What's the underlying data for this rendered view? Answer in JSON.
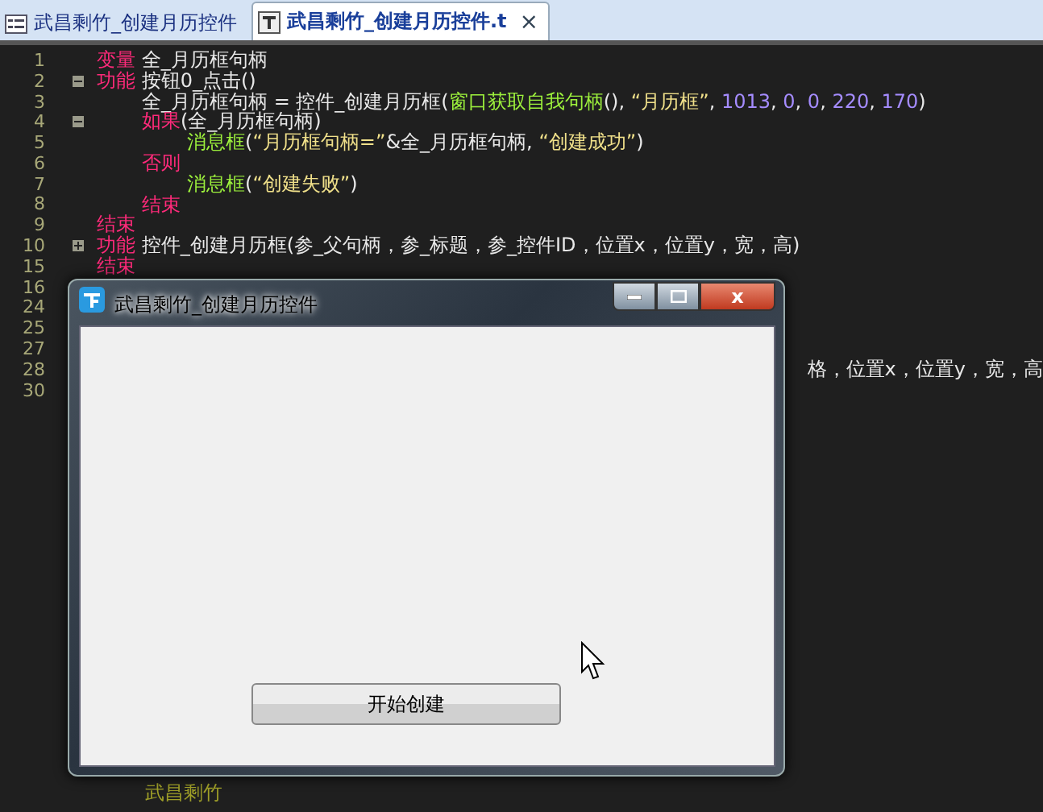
{
  "tabs": [
    {
      "label": "武昌剩竹_创建月历控件",
      "selected": false,
      "kind": "form"
    },
    {
      "label": "武昌剩竹_创建月历控件.t",
      "selected": true,
      "kind": "text",
      "close": "×"
    }
  ],
  "editor": {
    "lines": [
      {
        "number": "1",
        "segments": [
          {
            "kind": "keyword",
            "text": "变量"
          },
          {
            "kind": "plain",
            "text": " 全_月历框句柄"
          }
        ]
      },
      {
        "number": "2",
        "expanded": true,
        "segments": [
          {
            "kind": "keyword",
            "text": "功能"
          },
          {
            "kind": "plain",
            "text": " 按钮0_点击()"
          }
        ],
        "children": [
          {
            "number": "3",
            "segments": [
              {
                "kind": "plain",
                "text": "全_月历框句柄 = 控件_创建月历框("
              },
              {
                "kind": "func",
                "text": "窗口获取自我句柄"
              },
              {
                "kind": "plain",
                "text": "(), "
              },
              {
                "kind": "string",
                "text": "“月历框”"
              },
              {
                "kind": "plain",
                "text": ", "
              },
              {
                "kind": "number",
                "text": "1013"
              },
              {
                "kind": "plain",
                "text": ", "
              },
              {
                "kind": "number",
                "text": "0"
              },
              {
                "kind": "plain",
                "text": ", "
              },
              {
                "kind": "number",
                "text": "0"
              },
              {
                "kind": "plain",
                "text": ", "
              },
              {
                "kind": "number",
                "text": "220"
              },
              {
                "kind": "plain",
                "text": ", "
              },
              {
                "kind": "number",
                "text": "170"
              },
              {
                "kind": "plain",
                "text": ")"
              }
            ]
          },
          {
            "number": "4",
            "expanded": true,
            "segments": [
              {
                "kind": "keyword",
                "text": "如果"
              },
              {
                "kind": "plain",
                "text": "(全_月历框句柄)"
              }
            ],
            "children": [
              {
                "number": "5",
                "segments": [
                  {
                    "kind": "func",
                    "text": "消息框"
                  },
                  {
                    "kind": "plain",
                    "text": "("
                  },
                  {
                    "kind": "string",
                    "text": "“月历框句柄=”"
                  },
                  {
                    "kind": "plain",
                    "text": "&全_月历框句柄, "
                  },
                  {
                    "kind": "string",
                    "text": "“创建成功”"
                  },
                  {
                    "kind": "plain",
                    "text": ")"
                  }
                ]
              }
            ]
          },
          {
            "number": "6",
            "segments": [
              {
                "kind": "keyword",
                "text": "否则"
              }
            ],
            "children": [
              {
                "number": "7",
                "segments": [
                  {
                    "kind": "func",
                    "text": "消息框"
                  },
                  {
                    "kind": "plain",
                    "text": "("
                  },
                  {
                    "kind": "string",
                    "text": "“创建失败”"
                  },
                  {
                    "kind": "plain",
                    "text": ")"
                  }
                ]
              }
            ]
          },
          {
            "number": "8",
            "segments": [
              {
                "kind": "keyword",
                "text": "结束"
              }
            ]
          }
        ]
      },
      {
        "number": "9",
        "segments": [
          {
            "kind": "keyword",
            "text": "结束"
          }
        ]
      },
      {
        "number": "10",
        "expanded": false,
        "segments": [
          {
            "kind": "keyword",
            "text": "功能"
          },
          {
            "kind": "plain",
            "text": " 控件_创建月历框(参_父句柄，参_标题，参_控件ID，位置x，位置y，宽，高)"
          }
        ]
      },
      {
        "number": "15",
        "segments": [
          {
            "kind": "keyword",
            "text": "结束"
          }
        ]
      },
      {
        "number": "16"
      },
      {
        "number": "24"
      },
      {
        "number": "25"
      },
      {
        "number": "27"
      },
      {
        "number": "28",
        "clipped": true,
        "segments": [
          {
            "kind": "plain",
            "text": "格，位置x，位置y，宽，高"
          }
        ]
      },
      {
        "number": "30"
      }
    ],
    "footer_text": "武昌剩竹"
  },
  "dialog": {
    "title": "武昌剩竹_创建月历控件",
    "close": "x",
    "button": "开始创建"
  }
}
